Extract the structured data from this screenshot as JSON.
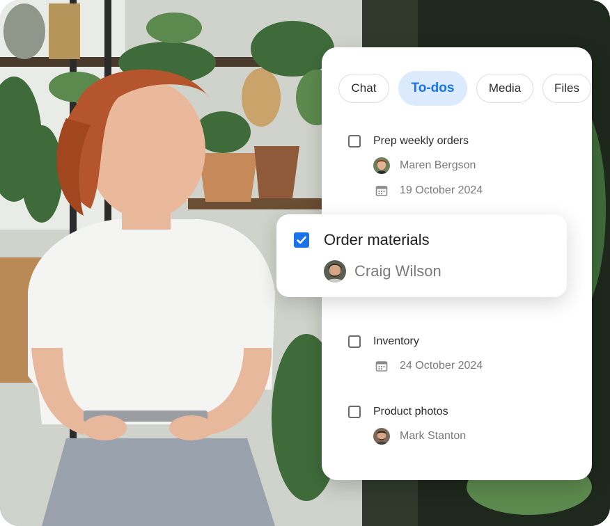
{
  "tabs": [
    {
      "label": "Chat",
      "active": false
    },
    {
      "label": "To-dos",
      "active": true
    },
    {
      "label": "Media",
      "active": false
    },
    {
      "label": "Files",
      "active": false
    }
  ],
  "todos": [
    {
      "title": "Prep weekly orders",
      "checked": false,
      "assignee": "Maren Bergson",
      "date": "19 October 2024"
    },
    {
      "title": "Order materials",
      "checked": true,
      "assignee": "Craig Wilson"
    },
    {
      "title": "Inventory",
      "checked": false,
      "date": "24 October 2024"
    },
    {
      "title": "Product photos",
      "checked": false,
      "assignee": "Mark Stanton"
    }
  ],
  "colors": {
    "accent": "#1a73e8",
    "active_tab_bg": "#dbeafc",
    "muted_text": "#7a7a7a"
  },
  "icons": {
    "date": "calendar-icon",
    "check": "checkmark-icon"
  }
}
